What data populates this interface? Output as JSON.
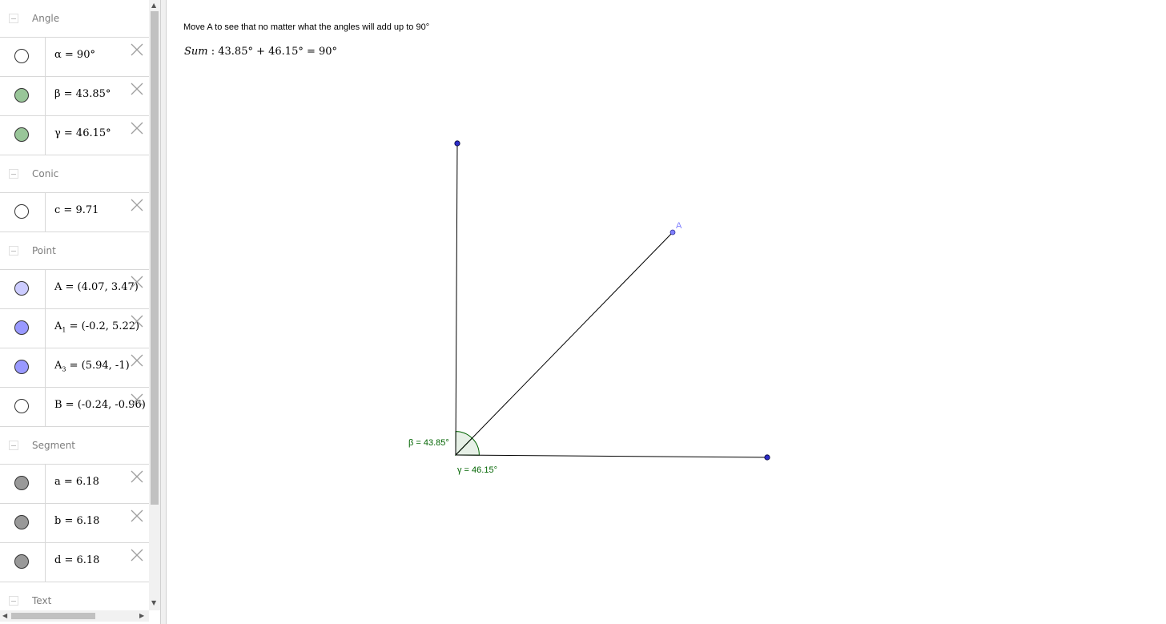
{
  "algebra": {
    "groups": [
      {
        "name": "Angle",
        "items": [
          {
            "label": "α = 90°",
            "color": "#ffffff"
          },
          {
            "label": "β = 43.85°",
            "color": "#99c699"
          },
          {
            "label": "γ = 46.15°",
            "color": "#99c699"
          }
        ]
      },
      {
        "name": "Conic",
        "items": [
          {
            "label": "c = 9.71",
            "color": "#ffffff"
          }
        ]
      },
      {
        "name": "Point",
        "items": [
          {
            "label": "A = (4.07, 3.47)",
            "color": "#ccccff"
          },
          {
            "base": "A",
            "sub": "1",
            "label": " = (-0.2, 5.22)",
            "color": "#9999ff"
          },
          {
            "base": "A",
            "sub": "3",
            "label": " = (5.94, -1)",
            "color": "#9999ff"
          },
          {
            "label": "B = (-0.24, -0.96)",
            "color": "#ffffff"
          }
        ]
      },
      {
        "name": "Segment",
        "items": [
          {
            "label": "a = 6.18",
            "color": "#999999"
          },
          {
            "label": "b = 6.18",
            "color": "#999999"
          },
          {
            "label": "d = 6.18",
            "color": "#999999"
          }
        ]
      },
      {
        "name": "Text",
        "items": []
      }
    ]
  },
  "graphics": {
    "instruction": "Move A to see that no matter what the angles will add up to 90°",
    "sum_label": "Sum",
    "sum_expr": " : 43.85° + 46.15° = 90°",
    "point_A_label": "A",
    "beta_label": "β = 43.85°",
    "gamma_label": "γ = 46.15°",
    "colors": {
      "point_blue": "#2c2cc8",
      "point_A": "#7f7fff",
      "angle_green": "#006400",
      "angle_fill": "#e6f0e6",
      "segment": "#000000"
    }
  }
}
